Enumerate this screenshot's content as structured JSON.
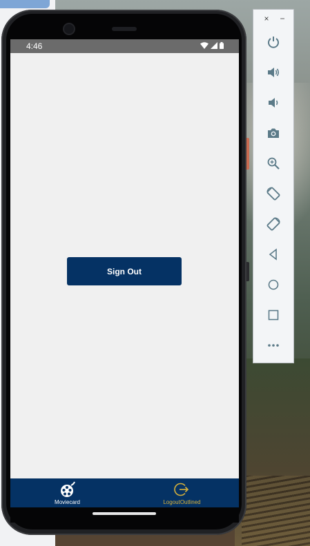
{
  "status_bar": {
    "time": "4:46"
  },
  "main": {
    "signout_label": "Sign Out"
  },
  "tabbar": {
    "tabs": [
      {
        "label": "Moviecard",
        "icon": "movie-reel-icon",
        "active": true
      },
      {
        "label": "LogoutOutlined",
        "icon": "logout-outlined-icon",
        "active": false
      }
    ]
  },
  "emulator_toolbar": {
    "close_label": "×",
    "minimize_label": "−",
    "buttons": [
      "power-icon",
      "volume-up-icon",
      "volume-down-icon",
      "camera-icon",
      "zoom-icon",
      "rotate-left-icon",
      "rotate-right-icon",
      "back-icon",
      "home-icon",
      "overview-icon",
      "more-icon"
    ]
  },
  "colors": {
    "brand": "#053264",
    "accent": "#d8b23b",
    "screen_bg": "#f0f0f0"
  }
}
